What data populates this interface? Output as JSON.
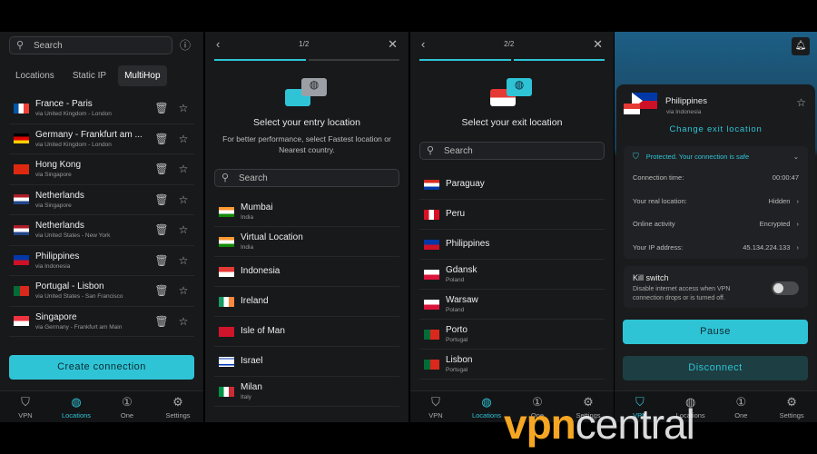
{
  "colors": {
    "accent": "#2ec4d6",
    "background": "#18191b"
  },
  "panel1": {
    "search_placeholder": "Search",
    "tabs": [
      "Locations",
      "Static IP",
      "MultiHop"
    ],
    "rows": [
      {
        "name": "France - Paris",
        "via": "via United Kingdom - London",
        "flag": "fr"
      },
      {
        "name": "Germany - Frankfurt am ...",
        "via": "via United Kingdom - London",
        "flag": "de"
      },
      {
        "name": "Hong Kong",
        "via": "via Singapore",
        "flag": "hk"
      },
      {
        "name": "Netherlands",
        "via": "via Singapore",
        "flag": "nl"
      },
      {
        "name": "Netherlands",
        "via": "via United States - New York",
        "flag": "nl"
      },
      {
        "name": "Philippines",
        "via": "via Indonesia",
        "flag": "ph"
      },
      {
        "name": "Portugal - Lisbon",
        "via": "via United States - San Francisco",
        "flag": "pt"
      },
      {
        "name": "Singapore",
        "via": "via Germany - Frankfurt am Main",
        "flag": "sg"
      }
    ],
    "create_button": "Create connection"
  },
  "nav": [
    {
      "label": "VPN",
      "icon": "shield-icon"
    },
    {
      "label": "Locations",
      "icon": "globe-icon"
    },
    {
      "label": "One",
      "icon": "one-icon"
    },
    {
      "label": "Settings",
      "icon": "gear-icon"
    }
  ],
  "panel2": {
    "step": "1/2",
    "title": "Select your entry location",
    "subtitle": "For better performance, select Fastest location or Nearest country.",
    "search_placeholder": "Search",
    "rows": [
      {
        "name": "Mumbai",
        "sub": "India",
        "flag": "in"
      },
      {
        "name": "Virtual Location",
        "sub": "India",
        "flag": "in"
      },
      {
        "name": "Indonesia",
        "sub": "",
        "flag": "id"
      },
      {
        "name": "Ireland",
        "sub": "",
        "flag": "ie"
      },
      {
        "name": "Isle of Man",
        "sub": "",
        "flag": "im"
      },
      {
        "name": "Israel",
        "sub": "",
        "flag": "il"
      },
      {
        "name": "Milan",
        "sub": "Italy",
        "flag": "it"
      }
    ]
  },
  "panel3": {
    "step": "2/2",
    "title": "Select your exit location",
    "search_placeholder": "Search",
    "rows": [
      {
        "name": "Paraguay",
        "sub": "",
        "flag": "py"
      },
      {
        "name": "Peru",
        "sub": "",
        "flag": "pe"
      },
      {
        "name": "Philippines",
        "sub": "",
        "flag": "ph"
      },
      {
        "name": "Gdansk",
        "sub": "Poland",
        "flag": "pl"
      },
      {
        "name": "Warsaw",
        "sub": "Poland",
        "flag": "pl"
      },
      {
        "name": "Porto",
        "sub": "Portugal",
        "flag": "pt"
      },
      {
        "name": "Lisbon",
        "sub": "Portugal",
        "flag": "pt"
      }
    ]
  },
  "panel4": {
    "location": "Philippines",
    "via": "via Indonesia",
    "change_exit": "Change exit location",
    "status": "Protected. Your connection is safe",
    "details": [
      {
        "label": "Connection time:",
        "value": "00:00:47"
      },
      {
        "label": "Your real location:",
        "value": "Hidden"
      },
      {
        "label": "Online activity",
        "value": "Encrypted"
      },
      {
        "label": "Your IP address:",
        "value": "45.134.224.133"
      }
    ],
    "kill_switch_title": "Kill switch",
    "kill_switch_desc": "Disable internet access when VPN connection drops or is turned off.",
    "kill_switch_on": false,
    "pause": "Pause",
    "disconnect": "Disconnect"
  },
  "watermark": "vpncentral"
}
